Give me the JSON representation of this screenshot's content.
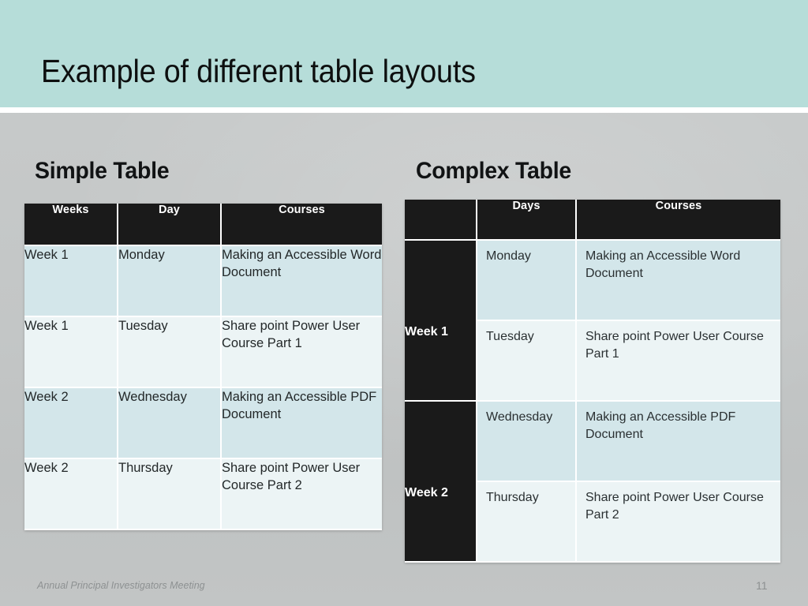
{
  "slide": {
    "title": "Example of different table layouts",
    "band_color": "#b6ddd9",
    "background_color": "#c5c8c8"
  },
  "simple_table": {
    "heading": "Simple Table",
    "columns": [
      "Weeks",
      "Day",
      "Courses"
    ],
    "rows": [
      [
        "Week 1",
        "Monday",
        "Making an Accessible Word Document"
      ],
      [
        "Week 1",
        "Tuesday",
        "Share point Power User Course Part 1"
      ],
      [
        "Week 2",
        "Wednesday",
        "Making an Accessible PDF Document"
      ],
      [
        "Week 2",
        "Thursday",
        "Share point Power User Course Part 2"
      ]
    ]
  },
  "complex_table": {
    "heading": "Complex Table",
    "columns": [
      "",
      "Days",
      "Courses"
    ],
    "groups": [
      {
        "label": "Week 1",
        "rows": [
          [
            "Monday",
            "Making an Accessible Word Document"
          ],
          [
            "Tuesday",
            "Share point Power User Course Part 1"
          ]
        ]
      },
      {
        "label": "Week 2",
        "rows": [
          [
            "Wednesday",
            "Making an Accessible PDF Document"
          ],
          [
            "Thursday",
            "Share point Power User Course Part 2"
          ]
        ]
      }
    ]
  },
  "footer": {
    "text": "Annual Principal Investigators Meeting",
    "page_number": "11"
  }
}
